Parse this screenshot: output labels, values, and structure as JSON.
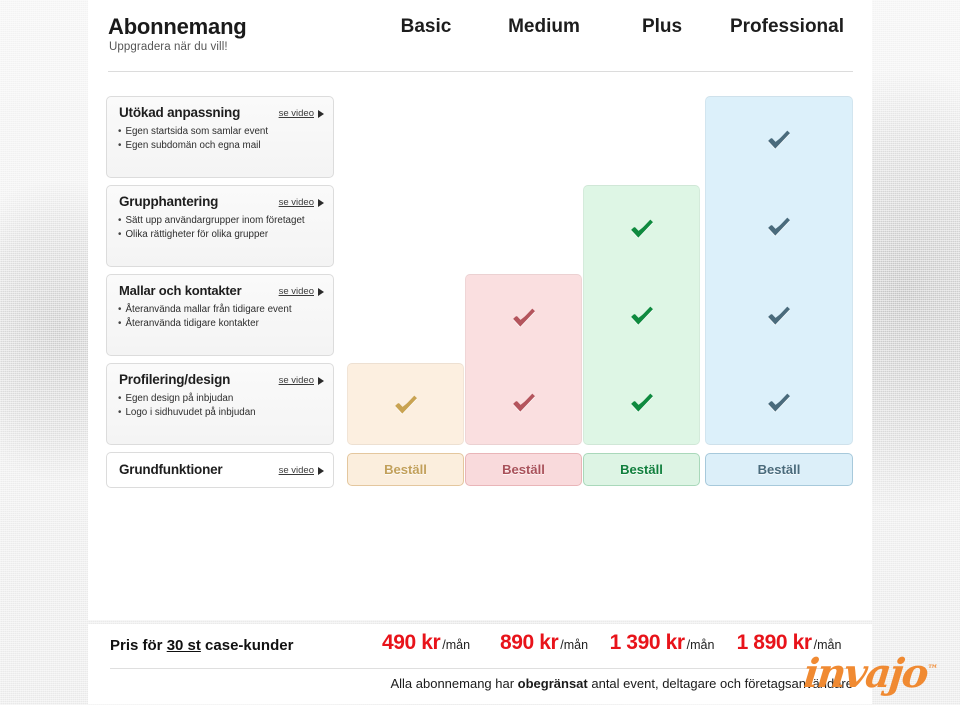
{
  "header": {
    "title": "Abonnemang",
    "subtitle": "Uppgradera när du vill!",
    "plans": [
      "Basic",
      "Medium",
      "Plus",
      "Professional"
    ]
  },
  "video_link_label": "se video",
  "features": [
    {
      "title": "Utökad anpassning",
      "bullets": [
        "Egen startsida som samlar event",
        "Egen subdomän och egna mail"
      ]
    },
    {
      "title": "Grupphantering",
      "bullets": [
        "Sätt upp användargrupper inom företaget",
        "Olika rättigheter för olika grupper"
      ]
    },
    {
      "title": "Mallar och kontakter",
      "bullets": [
        "Återanvända mallar från tidigare event",
        "Återanvända tidigare kontakter"
      ]
    },
    {
      "title": "Profilering/design",
      "bullets": [
        "Egen design på inbjudan",
        "Logo i sidhuvudet på inbjudan"
      ]
    },
    {
      "title": "Grundfunktioner",
      "bullets": []
    }
  ],
  "matrix": [
    [
      false,
      false,
      false,
      true
    ],
    [
      false,
      false,
      true,
      true
    ],
    [
      false,
      true,
      true,
      true
    ],
    [
      true,
      true,
      true,
      true
    ]
  ],
  "order_label": "Beställ",
  "pricing": {
    "label_pre": "Pris för ",
    "label_underline": "30 st",
    "label_post": " case-kunder",
    "amounts": [
      "490 kr",
      "890 kr",
      "1 390 kr",
      "1 890 kr"
    ],
    "per": "/mån",
    "price_color": "#e8131a",
    "note_pre": "Alla abonnemang har ",
    "note_bold": "obegränsat",
    "note_post": " antal event, deltagare och företagsanvändare"
  },
  "logo": {
    "text": "invajo",
    "tm": "™",
    "color": "#f08a32"
  },
  "colors": {
    "basic": {
      "bg": "#fcefe0",
      "border": "#eed9bd",
      "check": "#c9a352",
      "btn_bg": "#fbeedd",
      "btn_border": "#e4c79e",
      "btn_text": "#c2a05a"
    },
    "medium": {
      "bg": "#fadfe0",
      "border": "#f0c5c7",
      "check": "#b4555d",
      "btn_bg": "#f9dadc",
      "btn_border": "#e9b5b8",
      "btn_text": "#a9515a"
    },
    "plus": {
      "bg": "#def6e5",
      "border": "#bfe6cc",
      "check": "#0f8a3f",
      "btn_bg": "#ddf4e4",
      "btn_border": "#a9d8ba",
      "btn_text": "#0f7f3c"
    },
    "professional": {
      "bg": "#dcf0fa",
      "border": "#bcddee",
      "check": "#4a6b7c",
      "btn_bg": "#dceff9",
      "btn_border": "#a7c9db",
      "btn_text": "#4a6b7c"
    }
  }
}
